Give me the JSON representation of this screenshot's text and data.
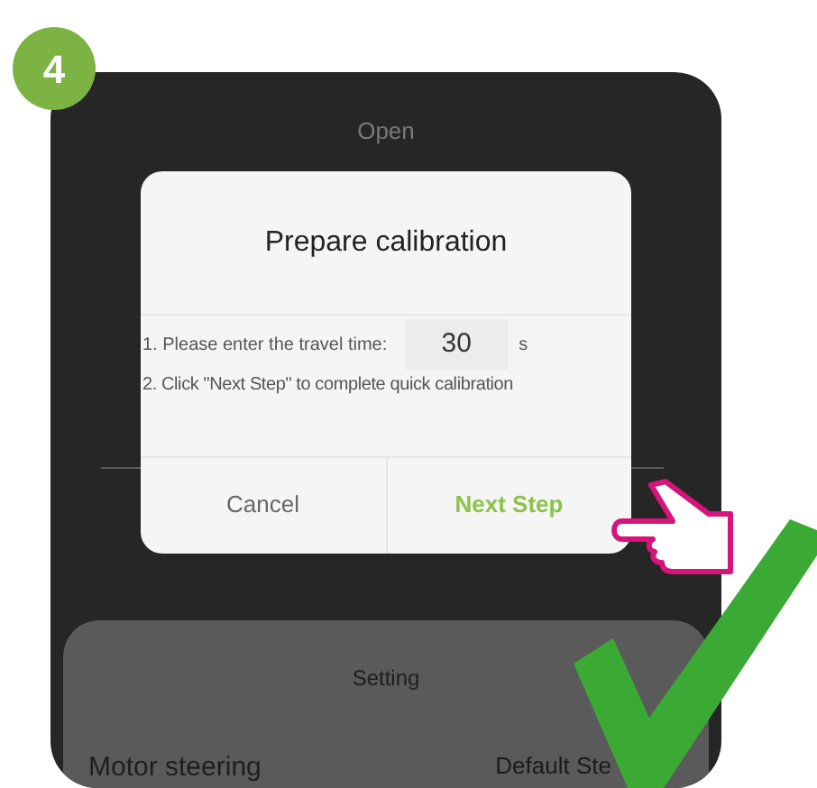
{
  "step_badge": "4",
  "header": "Open",
  "dialog": {
    "title": "Prepare calibration",
    "travel_time_label": "1. Please enter the travel time:",
    "travel_time": {
      "value": "30",
      "unit": "s"
    },
    "instruction": "2. Click \"Next Step\" to complete quick calibration",
    "buttons": [
      {
        "label": "Cancel",
        "kind": "secondary"
      },
      {
        "label": "Next Step",
        "kind": "primary"
      }
    ]
  },
  "settings": {
    "title": "Setting",
    "rows": [
      {
        "label": "Motor steering",
        "value": "Default Ste"
      }
    ]
  }
}
